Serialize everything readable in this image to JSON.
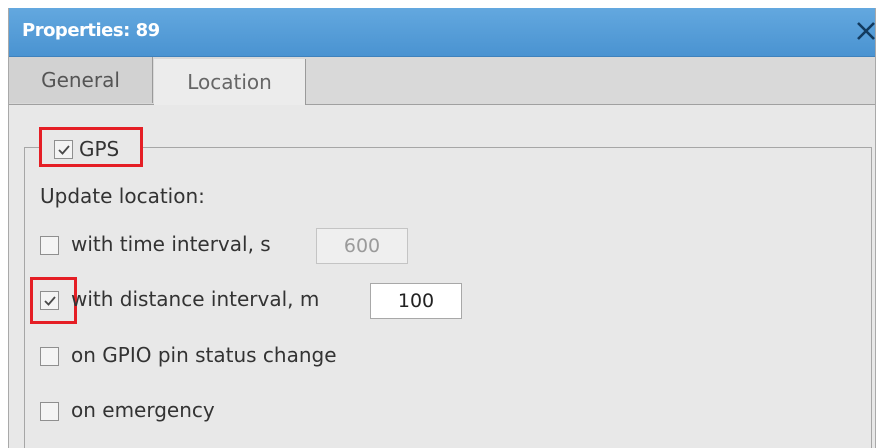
{
  "window": {
    "title": "Properties: 89",
    "close_icon": "close-icon"
  },
  "tabs": [
    {
      "label": "General",
      "active": true
    },
    {
      "label": "Location",
      "active": false
    }
  ],
  "gps": {
    "label": "GPS",
    "checked": true
  },
  "update_location": {
    "heading": "Update location:",
    "options": [
      {
        "label": "with time interval, s",
        "checked": false,
        "value": "600",
        "enabled": false
      },
      {
        "label": "with distance interval, m",
        "checked": true,
        "value": "100",
        "enabled": true
      },
      {
        "label": "on GPIO pin status change",
        "checked": false
      },
      {
        "label": "on emergency",
        "checked": false
      }
    ]
  },
  "colors": {
    "titlebar": "#4a93d1",
    "highlight": "#e51e25",
    "background": "#e8e8e8"
  }
}
